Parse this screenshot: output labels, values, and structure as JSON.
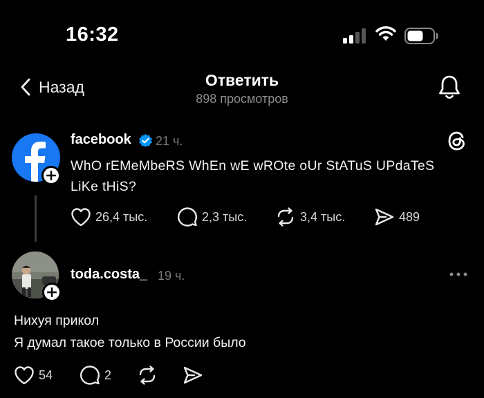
{
  "status_bar": {
    "time": "16:32"
  },
  "header": {
    "back_label": "Назад",
    "title": "Ответить",
    "subtitle": "898 просмотров"
  },
  "post": {
    "username": "facebook",
    "verified": true,
    "time_ago": "21 ч.",
    "text_line1": "WhO rEMeMbeRS WhEn wE wROte oUr StATuS UPdaTeS",
    "text_line2": "LiKe tHiS?",
    "likes": "26,4 тыс.",
    "comments": "2,3 тыс.",
    "reposts": "3,4 тыс.",
    "shares": "489"
  },
  "reply": {
    "username": "toda.costa_",
    "time_ago": "19 ч.",
    "text_line1": "Нихуя прикол",
    "text_line2": "Я думал такое только в России было",
    "likes": "54",
    "comments": "2"
  },
  "colors": {
    "background": "#000000",
    "facebook_blue": "#1877F2",
    "verified_blue": "#0095F6",
    "muted": "#8c8c8c"
  }
}
